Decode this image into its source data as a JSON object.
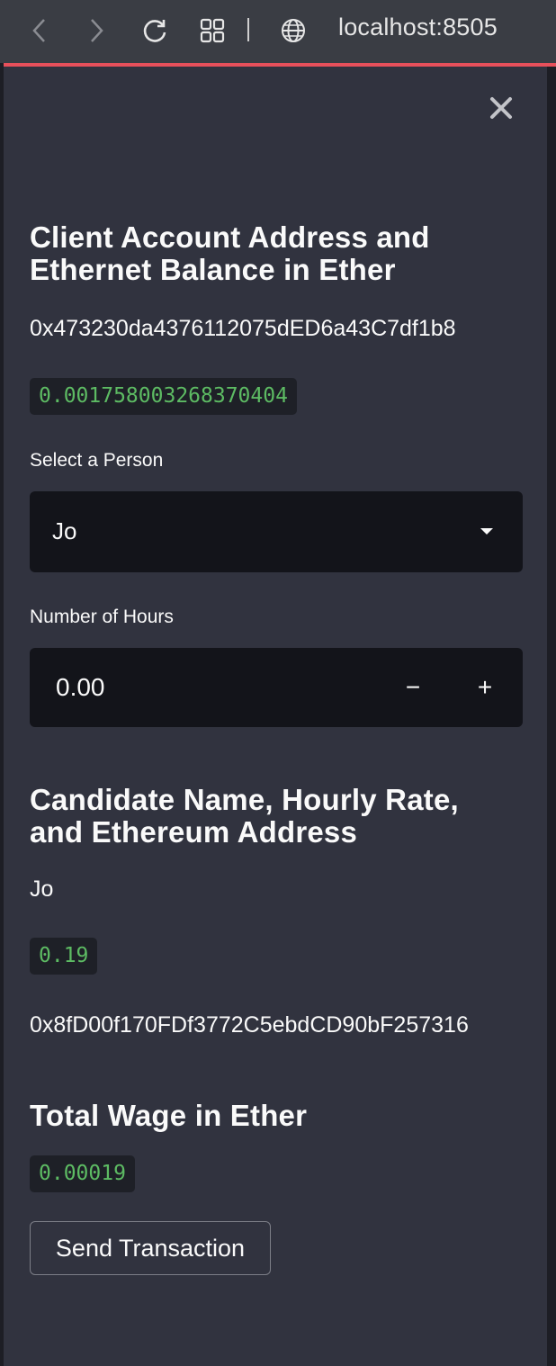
{
  "browser": {
    "url": "localhost:8505"
  },
  "sidebar": {
    "client_heading": "Client Account Address and\nEthernet Balance in Ether",
    "client_address": "0x473230da4376112075dED6a43C7df1b8",
    "client_balance": "0.001758003268370404",
    "select_label": "Select a Person",
    "select_value": "Jo",
    "hours_label": "Number of Hours",
    "hours_value": "0.00",
    "stepper_minus": "−",
    "stepper_plus": "+",
    "candidate_heading": "Candidate Name, Hourly Rate,\nand Ethereum Address",
    "candidate_name": "Jo",
    "candidate_rate": "0.19",
    "candidate_address": "0x8fD00f170FDf3772C5ebdCD90bF257316",
    "total_heading": "Total Wage in Ether",
    "total_wage": "0.00019",
    "send_button": "Send Transaction"
  },
  "colors": {
    "accent": "#e8505b",
    "sidebar_bg": "#31333f",
    "code_text": "#5dbb63"
  }
}
